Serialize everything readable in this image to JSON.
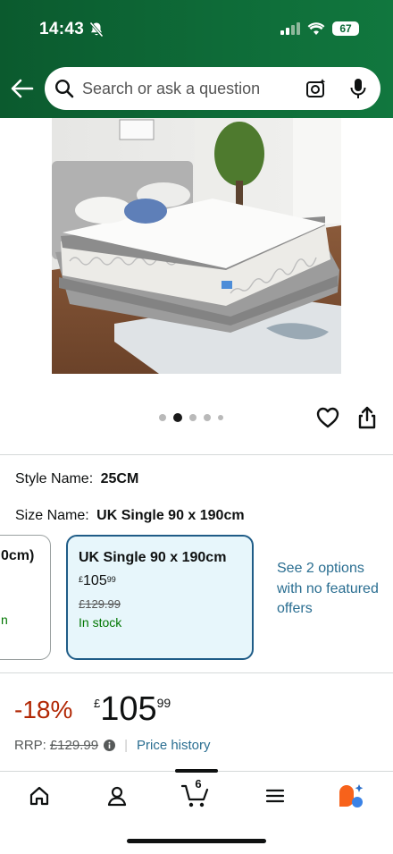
{
  "status_bar": {
    "time": "14:43",
    "battery": "67",
    "icons": [
      "bell-slash-icon",
      "signal-icon",
      "wifi-icon",
      "battery-icon"
    ]
  },
  "header": {
    "back_icon": "arrow-left-icon",
    "search_placeholder": "Search or ask a question",
    "icons": [
      "search-icon",
      "camera-search-icon",
      "microphone-icon"
    ],
    "colors": {
      "header_start": "#0b5a2e",
      "header_end": "#11773e"
    }
  },
  "gallery": {
    "image_subject": "mattress on grey upholstered bed frame",
    "dot_count": 5,
    "active_index": 1,
    "actions": [
      "heart-icon",
      "share-icon"
    ]
  },
  "variations": {
    "style": {
      "label": "Style Name:",
      "value": "25CM"
    },
    "size": {
      "label": "Size Name:",
      "value": "UK Single 90 x 190cm"
    },
    "cards": [
      {
        "title": "0cm)",
        "tail": "n",
        "selected": false
      },
      {
        "title": "UK Single 90 x 190cm",
        "price_symbol": "£",
        "price_whole": "105",
        "price_fraction": "99",
        "was_price": "£129.99",
        "stock": "In stock",
        "selected": true
      }
    ],
    "see_options": "See 2 options with no featured offers"
  },
  "pricing": {
    "discount": "-18%",
    "symbol": "£",
    "whole": "105",
    "fraction": "99",
    "rrp_label": "RRP:",
    "rrp_value": "£129.99",
    "price_history": "Price history",
    "colors": {
      "discount": "#b12704",
      "link": "#2a6e91",
      "in_stock": "#007600"
    }
  },
  "bottom_nav": {
    "items": [
      "home-icon",
      "account-icon",
      "cart-icon",
      "menu-icon",
      "rufus-icon"
    ],
    "cart_count": "6"
  }
}
